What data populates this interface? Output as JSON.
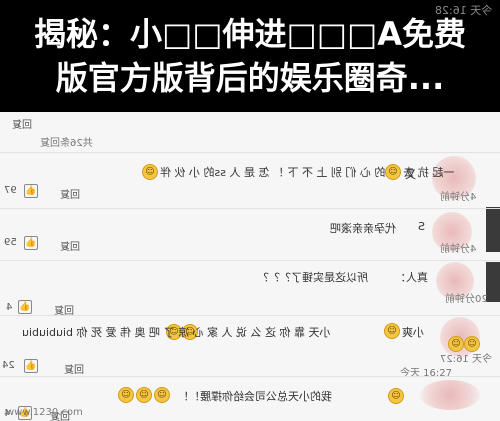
{
  "headline": {
    "line1": "揭秘：小□□伸进□□□A免费",
    "line2": "版官方版背后的娱乐圈奇..."
  },
  "top_time": "今天 16:28",
  "comments": [
    {
      "text_mirrored": "回复",
      "count": "",
      "time": "",
      "id": "c0"
    },
    {
      "text_mirrored": "共26条回复",
      "id": "c0b"
    },
    {
      "text_mirrored": "一起 抗 去 看 的 心 们 别 上 不 下 ！ 怎 是 人 ss的 小 伙 伴",
      "name": "又",
      "time": "4分钟前",
      "likes": "97",
      "reply": "回复"
    },
    {
      "text_mirrored": "代孕亲亲滚吧",
      "name": "S",
      "time": "4分钟前",
      "likes": "59",
      "reply": "回复"
    },
    {
      "text_mirrored": "所以这是实锤了？？？",
      "name": "真人：",
      "time": "20分钟前",
      "likes": "4",
      "reply": "回复"
    },
    {
      "text_mirrored": "小天 靠 你 这 么 说 人 家 心 凉 了 吧 奥 伟 爱 死 你 biubiubiu",
      "name": "小爽",
      "time": "今天 16:27",
      "likes": "24",
      "reply": "回复"
    },
    {
      "text_mirrored": "我的小天总公司会给你撑腰！！",
      "time": "",
      "likes": "4",
      "reply": "回复"
    }
  ],
  "watermark": "www.1230.com"
}
